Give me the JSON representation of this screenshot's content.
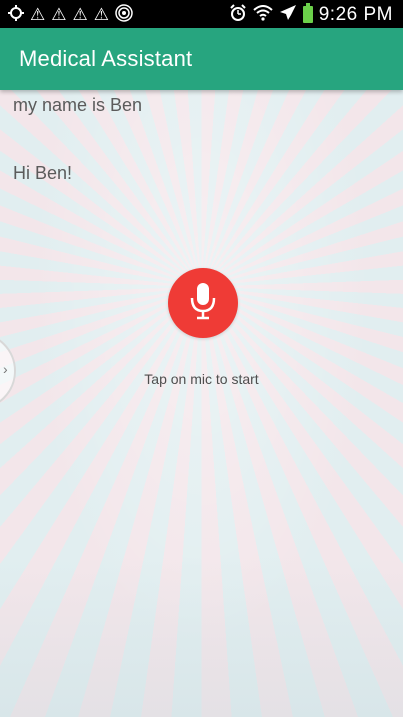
{
  "status_bar": {
    "time": "9:26 PM",
    "left_icons": [
      "location-target-icon",
      "warning-icon",
      "warning-icon",
      "warning-icon",
      "warning-icon",
      "signal-ring-icon"
    ],
    "right_icons": [
      "alarm-clock-icon",
      "wifi-icon",
      "airplane-icon",
      "battery-icon"
    ]
  },
  "app_bar": {
    "title": "Medical Assistant",
    "color": "#27a57f"
  },
  "conversation": {
    "user_message": "my name is Ben",
    "bot_message": "Hi Ben!"
  },
  "mic": {
    "hint": "Tap on mic to start",
    "color": "#ef3b36"
  }
}
